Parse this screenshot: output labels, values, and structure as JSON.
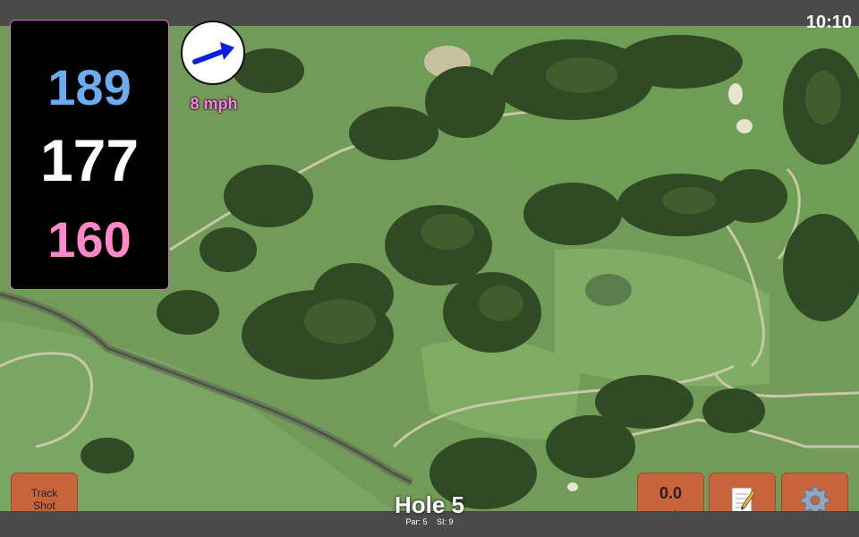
{
  "status": {
    "time": "10:10"
  },
  "distances": {
    "back": "189",
    "middle": "177",
    "front": "160"
  },
  "wind": {
    "speed_label": "8 mph",
    "arrow_icon": "arrow-right-icon",
    "arrow_color": "#0a1ee0",
    "value": "0.0",
    "unit": "mph"
  },
  "buttons": {
    "track_shot": "Track Shot",
    "notes_icon": "notepad-icon",
    "settings_icon": "gear-icon"
  },
  "hole": {
    "title": "Hole 5",
    "par": "Par: 5",
    "si": "SI: 9"
  },
  "colors": {
    "back": "#6aacec",
    "middle": "#ffffff",
    "front": "#ff88c8",
    "button": "#c8643c",
    "panel_border": "#d070d0"
  }
}
